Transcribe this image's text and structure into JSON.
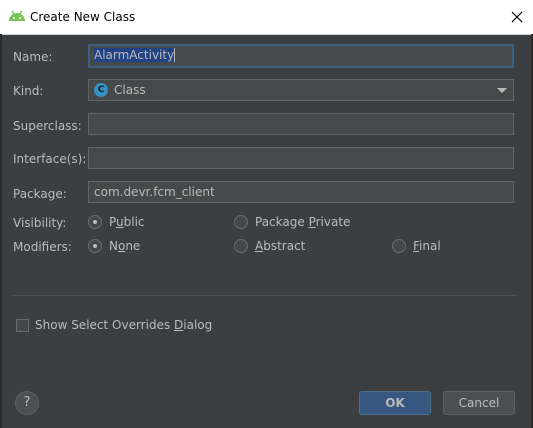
{
  "window": {
    "title": "Create New Class"
  },
  "form": {
    "name": {
      "label": "Name:",
      "value": "AlarmActivity"
    },
    "kind": {
      "label": "Kind:",
      "value": "Class",
      "icon_letter": "C"
    },
    "superclass": {
      "label": "Superclass:",
      "value": ""
    },
    "interfaces": {
      "label": "Interface(s):",
      "value": ""
    },
    "package": {
      "label": "Package:",
      "value": "com.devr.fcm_client"
    },
    "visibility": {
      "label": "Visibility:",
      "options": [
        {
          "pre": "P",
          "ul": "u",
          "post": "blic",
          "selected": true
        },
        {
          "pre": "Package ",
          "ul": "P",
          "post": "rivate",
          "selected": false
        }
      ]
    },
    "modifiers": {
      "label": "Modifiers:",
      "options": [
        {
          "pre": "N",
          "ul": "o",
          "post": "ne",
          "selected": true
        },
        {
          "pre": "",
          "ul": "A",
          "post": "bstract",
          "selected": false
        },
        {
          "pre": "",
          "ul": "F",
          "post": "inal",
          "selected": false
        }
      ]
    },
    "overrides": {
      "pre": "Show Select Overrides ",
      "ul": "D",
      "post": "ialog",
      "checked": false
    }
  },
  "buttons": {
    "help": "?",
    "ok": "OK",
    "cancel": "Cancel"
  },
  "colors": {
    "background": "#3c3f41",
    "accent": "#365880",
    "focus": "#3d6185",
    "android_green": "#78c257"
  }
}
